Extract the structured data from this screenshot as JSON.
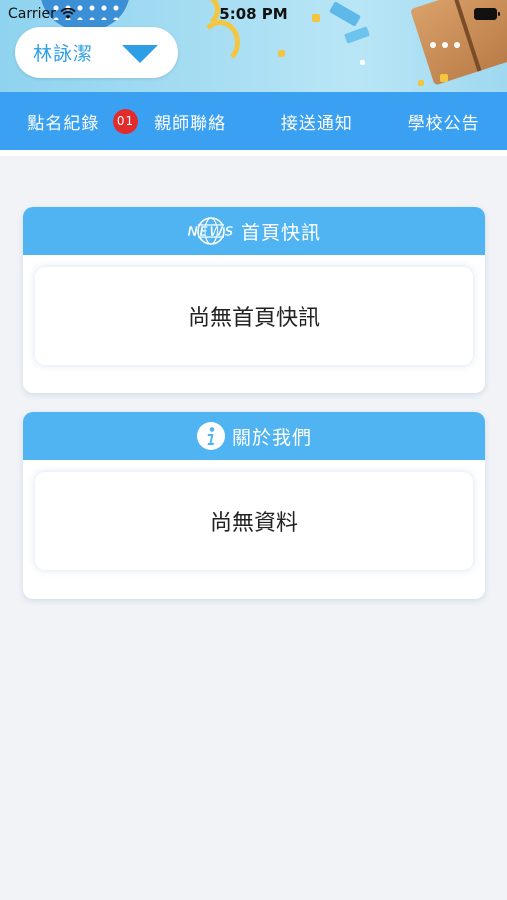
{
  "status_bar": {
    "carrier": "Carrier",
    "time": "5:08 PM"
  },
  "user_selector": {
    "name": "林詠潔"
  },
  "tabs": [
    {
      "label": "點名紀錄",
      "badge": "01"
    },
    {
      "label": "親師聯絡"
    },
    {
      "label": "接送通知"
    },
    {
      "label": "學校公告"
    }
  ],
  "cards": {
    "news": {
      "icon_text": "NEWS",
      "title": "首頁快訊",
      "empty_text": "尚無首頁快訊"
    },
    "about": {
      "title": "關於我們",
      "empty_text": "尚無資料"
    }
  },
  "colors": {
    "tab_bar": "#3aa0f1",
    "card_header": "#50b4f2",
    "accent_text": "#2e9fe6",
    "badge": "#e32b2b"
  },
  "icons": {
    "wifi": "wifi-icon",
    "battery": "battery-icon",
    "dropdown": "triangle-down-icon",
    "more": "more-dots-icon",
    "news": "news-globe-icon",
    "info": "info-icon"
  }
}
